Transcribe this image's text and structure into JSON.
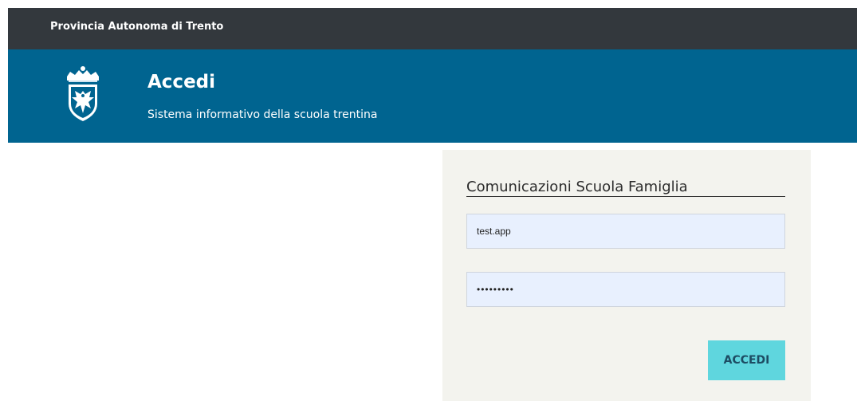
{
  "topbar": {
    "title": "Provincia Autonoma di Trento"
  },
  "header": {
    "title": "Accedi",
    "subtitle": "Sistema informativo della scuola trentina",
    "emblem_icon": "coat-of-arms-icon"
  },
  "login": {
    "form_title": "Comunicazioni Scuola Famiglia",
    "username_value": "test.app",
    "password_value": "•••••••••",
    "submit_label": "ACCEDI"
  },
  "colors": {
    "topbar": "#33383d",
    "header": "#006490",
    "panel": "#f3f3ee",
    "input": "#e8f0fe",
    "button": "#5fd6de",
    "button_text": "#1d4c63"
  }
}
